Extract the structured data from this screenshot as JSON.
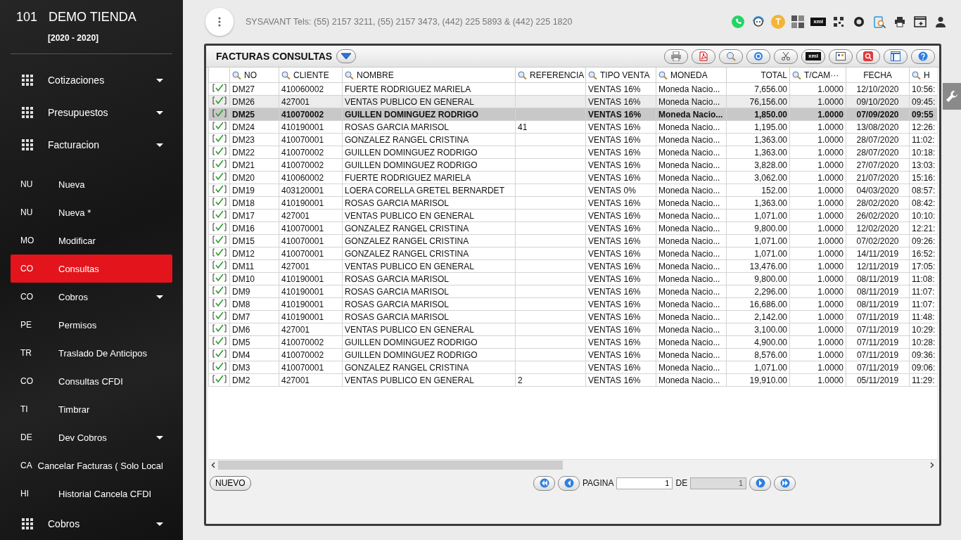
{
  "sidebar": {
    "code": "101",
    "company": "DEMO TIENDA",
    "period": "[2020 - 2020]",
    "items": [
      {
        "kind": "module",
        "label": "Cotizaciones",
        "expandable": true,
        "selected": false
      },
      {
        "kind": "module",
        "label": "Presupuestos",
        "expandable": true,
        "selected": false
      },
      {
        "kind": "module",
        "label": "Facturacion",
        "expandable": true,
        "selected": false
      },
      {
        "kind": "sub",
        "abbr": "NU",
        "label": "Nueva",
        "expandable": false,
        "selected": false
      },
      {
        "kind": "sub",
        "abbr": "NU",
        "label": "Nueva *",
        "expandable": false,
        "selected": false
      },
      {
        "kind": "sub",
        "abbr": "MO",
        "label": "Modificar",
        "expandable": false,
        "selected": false
      },
      {
        "kind": "sub",
        "abbr": "CO",
        "label": "Consultas",
        "expandable": false,
        "selected": true
      },
      {
        "kind": "sub",
        "abbr": "CO",
        "label": "Cobros",
        "expandable": true,
        "selected": false
      },
      {
        "kind": "sub",
        "abbr": "PE",
        "label": "Permisos",
        "expandable": false,
        "selected": false
      },
      {
        "kind": "sub",
        "abbr": "TR",
        "label": "Traslado De Anticipos",
        "expandable": false,
        "selected": false
      },
      {
        "kind": "sub",
        "abbr": "CO",
        "label": "Consultas CFDI",
        "expandable": false,
        "selected": false
      },
      {
        "kind": "sub",
        "abbr": "TI",
        "label": "Timbrar",
        "expandable": false,
        "selected": false
      },
      {
        "kind": "sub",
        "abbr": "DE",
        "label": "Dev Cobros",
        "expandable": true,
        "selected": false
      },
      {
        "kind": "sub",
        "abbr": "CA",
        "label": "Cancelar Facturas ( Solo Local",
        "expandable": false,
        "selected": false
      },
      {
        "kind": "sub",
        "abbr": "HI",
        "label": "Historial Cancela CFDI",
        "expandable": false,
        "selected": false
      },
      {
        "kind": "module",
        "label": "Cobros",
        "expandable": true,
        "selected": false
      }
    ]
  },
  "header": {
    "contact": "SYSAVANT Tels: (55) 2157 3211, (55) 2157 3473, (442) 225 5893 & (442) 225 1820",
    "user_badge": "T",
    "xml_label": "xml"
  },
  "panel": {
    "title": "FACTURAS CONSULTAS",
    "toolbar_xml_label": "xml",
    "columns": [
      {
        "label": "NO",
        "searchable": true
      },
      {
        "label": "CLIENTE",
        "searchable": true
      },
      {
        "label": "NOMBRE",
        "searchable": true
      },
      {
        "label": "REFERENCIA",
        "searchable": true
      },
      {
        "label": "TIPO VENTA",
        "searchable": true
      },
      {
        "label": "MONEDA",
        "searchable": true
      },
      {
        "label": "TOTAL",
        "searchable": false
      },
      {
        "label": "T/CAM···",
        "searchable": true
      },
      {
        "label": "FECHA",
        "searchable": false
      },
      {
        "label": "H",
        "searchable": true
      }
    ],
    "rows": [
      {
        "checked": true,
        "selected": false,
        "highlighted": false,
        "cells": [
          "DM27",
          "410060002",
          "FUERTE RODRIGUEZ MARIELA",
          null,
          "VENTAS 16%",
          "Moneda Nacio...",
          "7,656.00",
          "1.0000",
          "12/10/2020",
          "10:56:"
        ]
      },
      {
        "checked": true,
        "selected": false,
        "highlighted": true,
        "cells": [
          "DM26",
          "427001",
          "VENTAS PUBLICO EN GENERAL",
          null,
          "VENTAS 16%",
          "Moneda Nacio...",
          "76,156.00",
          "1.0000",
          "09/10/2020",
          "09:45:"
        ]
      },
      {
        "checked": true,
        "selected": true,
        "highlighted": false,
        "cells": [
          "DM25",
          "410070002",
          "GUILLEN DOMINGUEZ RODRIGO",
          null,
          "VENTAS 16%",
          "Moneda Nacio...",
          "1,850.00",
          "1.0000",
          "07/09/2020",
          "09:55"
        ]
      },
      {
        "checked": true,
        "selected": false,
        "highlighted": false,
        "cells": [
          "DM24",
          "410190001",
          "ROSAS GARCIA MARISOL",
          "41",
          "VENTAS 16%",
          "Moneda Nacio...",
          "1,195.00",
          "1.0000",
          "13/08/2020",
          "12:26:"
        ]
      },
      {
        "checked": true,
        "selected": false,
        "highlighted": false,
        "cells": [
          "DM23",
          "410070001",
          "GONZALEZ RANGEL CRISTINA",
          null,
          "VENTAS 16%",
          "Moneda Nacio...",
          "1,363.00",
          "1.0000",
          "28/07/2020",
          "11:02:"
        ]
      },
      {
        "checked": true,
        "selected": false,
        "highlighted": false,
        "cells": [
          "DM22",
          "410070002",
          "GUILLEN DOMINGUEZ RODRIGO",
          null,
          "VENTAS 16%",
          "Moneda Nacio...",
          "1,363.00",
          "1.0000",
          "28/07/2020",
          "10:18:"
        ]
      },
      {
        "checked": true,
        "selected": false,
        "highlighted": false,
        "cells": [
          "DM21",
          "410070002",
          "GUILLEN DOMINGUEZ RODRIGO",
          null,
          "VENTAS 16%",
          "Moneda Nacio...",
          "3,828.00",
          "1.0000",
          "27/07/2020",
          "13:03:"
        ]
      },
      {
        "checked": true,
        "selected": false,
        "highlighted": false,
        "cells": [
          "DM20",
          "410060002",
          "FUERTE RODRIGUEZ MARIELA",
          null,
          "VENTAS 16%",
          "Moneda Nacio...",
          "3,062.00",
          "1.0000",
          "21/07/2020",
          "15:16:"
        ]
      },
      {
        "checked": true,
        "selected": false,
        "highlighted": false,
        "cells": [
          "DM19",
          "403120001",
          "LOERA CORELLA GRETEL BERNARDET",
          null,
          "VENTAS 0%",
          "Moneda Nacio...",
          "152.00",
          "1.0000",
          "04/03/2020",
          "08:57:"
        ]
      },
      {
        "checked": true,
        "selected": false,
        "highlighted": false,
        "cells": [
          "DM18",
          "410190001",
          "ROSAS GARCIA MARISOL",
          null,
          "VENTAS 16%",
          "Moneda Nacio...",
          "1,363.00",
          "1.0000",
          "28/02/2020",
          "08:42:"
        ]
      },
      {
        "checked": true,
        "selected": false,
        "highlighted": false,
        "cells": [
          "DM17",
          "427001",
          "VENTAS PUBLICO EN GENERAL",
          null,
          "VENTAS 16%",
          "Moneda Nacio...",
          "1,071.00",
          "1.0000",
          "26/02/2020",
          "10:10:"
        ]
      },
      {
        "checked": true,
        "selected": false,
        "highlighted": false,
        "cells": [
          "DM16",
          "410070001",
          "GONZALEZ RANGEL CRISTINA",
          null,
          "VENTAS 16%",
          "Moneda Nacio...",
          "9,800.00",
          "1.0000",
          "12/02/2020",
          "12:21:"
        ]
      },
      {
        "checked": true,
        "selected": false,
        "highlighted": false,
        "cells": [
          "DM15",
          "410070001",
          "GONZALEZ RANGEL CRISTINA",
          null,
          "VENTAS 16%",
          "Moneda Nacio...",
          "1,071.00",
          "1.0000",
          "07/02/2020",
          "09:26:"
        ]
      },
      {
        "checked": true,
        "selected": false,
        "highlighted": false,
        "cells": [
          "DM12",
          "410070001",
          "GONZALEZ RANGEL CRISTINA",
          null,
          "VENTAS 16%",
          "Moneda Nacio...",
          "1,071.00",
          "1.0000",
          "14/11/2019",
          "16:52:"
        ]
      },
      {
        "checked": true,
        "selected": false,
        "highlighted": false,
        "cells": [
          "DM11",
          "427001",
          "VENTAS PUBLICO EN GENERAL",
          null,
          "VENTAS 16%",
          "Moneda Nacio...",
          "13,476.00",
          "1.0000",
          "12/11/2019",
          "17:05:"
        ]
      },
      {
        "checked": true,
        "selected": false,
        "highlighted": false,
        "cells": [
          "DM10",
          "410190001",
          "ROSAS GARCIA MARISOL",
          null,
          "VENTAS 16%",
          "Moneda Nacio...",
          "9,800.00",
          "1.0000",
          "08/11/2019",
          "11:08:"
        ]
      },
      {
        "checked": true,
        "selected": false,
        "highlighted": false,
        "cells": [
          "DM9",
          "410190001",
          "ROSAS GARCIA MARISOL",
          null,
          "VENTAS 16%",
          "Moneda Nacio...",
          "2,296.00",
          "1.0000",
          "08/11/2019",
          "11:07:"
        ]
      },
      {
        "checked": true,
        "selected": false,
        "highlighted": false,
        "cells": [
          "DM8",
          "410190001",
          "ROSAS GARCIA MARISOL",
          null,
          "VENTAS 16%",
          "Moneda Nacio...",
          "16,686.00",
          "1.0000",
          "08/11/2019",
          "11:07:"
        ]
      },
      {
        "checked": true,
        "selected": false,
        "highlighted": false,
        "cells": [
          "DM7",
          "410190001",
          "ROSAS GARCIA MARISOL",
          null,
          "VENTAS 16%",
          "Moneda Nacio...",
          "2,142.00",
          "1.0000",
          "07/11/2019",
          "11:48:"
        ]
      },
      {
        "checked": true,
        "selected": false,
        "highlighted": false,
        "cells": [
          "DM6",
          "427001",
          "VENTAS PUBLICO EN GENERAL",
          null,
          "VENTAS 16%",
          "Moneda Nacio...",
          "3,100.00",
          "1.0000",
          "07/11/2019",
          "10:29:"
        ]
      },
      {
        "checked": true,
        "selected": false,
        "highlighted": false,
        "cells": [
          "DM5",
          "410070002",
          "GUILLEN DOMINGUEZ RODRIGO",
          null,
          "VENTAS 16%",
          "Moneda Nacio...",
          "4,900.00",
          "1.0000",
          "07/11/2019",
          "10:28:"
        ]
      },
      {
        "checked": true,
        "selected": false,
        "highlighted": false,
        "cells": [
          "DM4",
          "410070002",
          "GUILLEN DOMINGUEZ RODRIGO",
          null,
          "VENTAS 16%",
          "Moneda Nacio...",
          "8,576.00",
          "1.0000",
          "07/11/2019",
          "09:36:"
        ]
      },
      {
        "checked": true,
        "selected": false,
        "highlighted": false,
        "cells": [
          "DM3",
          "410070001",
          "GONZALEZ RANGEL CRISTINA",
          null,
          "VENTAS 16%",
          "Moneda Nacio...",
          "1,071.00",
          "1.0000",
          "07/11/2019",
          "09:06:"
        ]
      },
      {
        "checked": true,
        "selected": false,
        "highlighted": false,
        "cells": [
          "DM2",
          "427001",
          "VENTAS PUBLICO EN GENERAL",
          "2",
          "VENTAS 16%",
          "Moneda Nacio...",
          "19,910.00",
          "1.0000",
          "05/11/2019",
          "11:29:"
        ]
      }
    ],
    "pager": {
      "new_button": "NUEVO",
      "page_label": "PAGINA",
      "page": "1",
      "of_label": "DE",
      "total_pages": "1"
    }
  }
}
